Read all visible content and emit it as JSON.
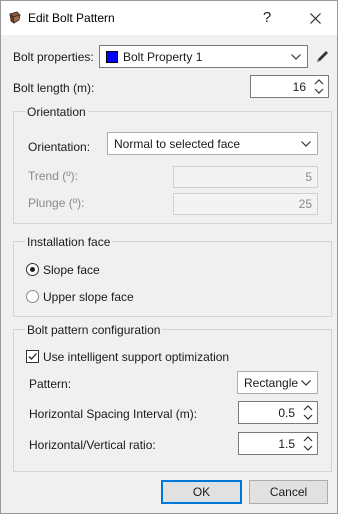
{
  "window": {
    "title": "Edit Bolt Pattern",
    "help_glyph": "?",
    "close_glyph": "×"
  },
  "bolt_properties": {
    "label": "Bolt properties:",
    "selected": "Bolt Property 1",
    "swatch_color": "#0000ff"
  },
  "bolt_length": {
    "label": "Bolt length (m):",
    "value": "16"
  },
  "orientation_group": {
    "title": "Orientation",
    "orientation_label": "Orientation:",
    "orientation_value": "Normal to selected face",
    "trend_label": "Trend (º):",
    "trend_value": "5",
    "plunge_label": "Plunge (º):",
    "plunge_value": "25"
  },
  "installation_group": {
    "title": "Installation face",
    "options": [
      {
        "label": "Slope face",
        "selected": true
      },
      {
        "label": "Upper slope face",
        "selected": false
      }
    ]
  },
  "pattern_group": {
    "title": "Bolt pattern configuration",
    "optimization_label": "Use intelligent support optimization",
    "optimization_checked": true,
    "pattern_label": "Pattern:",
    "pattern_value": "Rectangle",
    "spacing_label": "Horizontal Spacing Interval (m):",
    "spacing_value": "0.5",
    "ratio_label": "Horizontal/Vertical ratio:",
    "ratio_value": "1.5"
  },
  "buttons": {
    "ok": "OK",
    "cancel": "Cancel"
  },
  "colors": {
    "accent": "#0078d7",
    "dialog_bg": "#f0f0f0"
  }
}
